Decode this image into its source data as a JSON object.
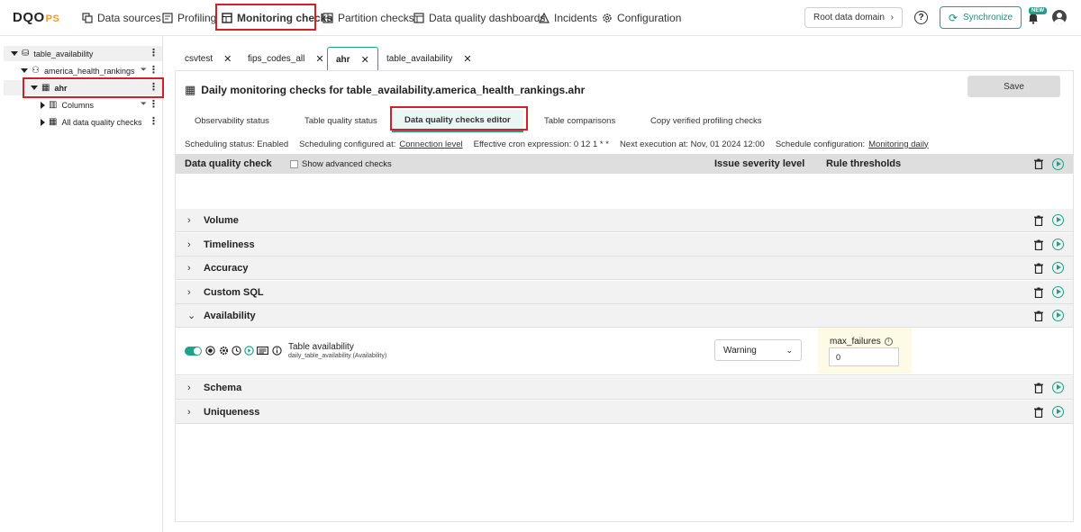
{
  "logo": {
    "main": "DQO",
    "suffix": "PS"
  },
  "nav": {
    "items": [
      {
        "label": "Data sources",
        "icon": "data-sources-icon"
      },
      {
        "label": "Profiling",
        "icon": "profiling-icon"
      },
      {
        "label": "Monitoring checks",
        "icon": "monitoring-icon"
      },
      {
        "label": "Partition checks",
        "icon": "partition-icon"
      },
      {
        "label": "Data quality dashboards",
        "icon": "dashboard-icon"
      },
      {
        "label": "Incidents",
        "icon": "warning-icon"
      },
      {
        "label": "Configuration",
        "icon": "gear-icon"
      }
    ],
    "root_domain": "Root data domain",
    "help": "?",
    "synchronize": "Synchronize",
    "new_badge": "NEW"
  },
  "tree": {
    "items": [
      {
        "label": "table_availability"
      },
      {
        "label": "america_health_rankings"
      },
      {
        "label": "ahr"
      },
      {
        "label": "Columns"
      },
      {
        "label": "All data quality checks"
      }
    ]
  },
  "tabs": [
    {
      "label": "csvtest"
    },
    {
      "label": "fips_codes_all"
    },
    {
      "label": "ahr"
    },
    {
      "label": "table_availability"
    }
  ],
  "page": {
    "title": "Daily monitoring checks for table_availability.america_health_rankings.ahr",
    "save": "Save"
  },
  "subtabs": [
    {
      "label": "Observability status"
    },
    {
      "label": "Table quality status"
    },
    {
      "label": "Data quality checks editor"
    },
    {
      "label": "Table comparisons"
    },
    {
      "label": "Copy verified profiling checks"
    }
  ],
  "info": {
    "scheduling_status": "Scheduling status: Enabled",
    "configured_prefix": "Scheduling configured at:",
    "configured_link": "Connection level",
    "cron": "Effective cron expression: 0 12 1 * *",
    "next": "Next execution at: Nov, 01 2024 12:00",
    "schedule_prefix": "Schedule configuration:",
    "schedule_link": "Monitoring daily"
  },
  "table": {
    "col_check": "Data quality check",
    "show_advanced": "Show advanced checks",
    "col_severity": "Issue severity level",
    "col_rules": "Rule thresholds",
    "groups": [
      "Volume",
      "Timeliness",
      "Accuracy",
      "Custom SQL",
      "Availability",
      "Schema",
      "Uniqueness"
    ]
  },
  "check": {
    "name": "Table availability",
    "sub": "daily_table_availability (Availability)",
    "severity": "Warning",
    "threshold_label": "max_failures",
    "threshold_value": "0",
    "enabled": true
  },
  "colors": {
    "accent": "#1fa187",
    "highlight": "#d32027"
  }
}
